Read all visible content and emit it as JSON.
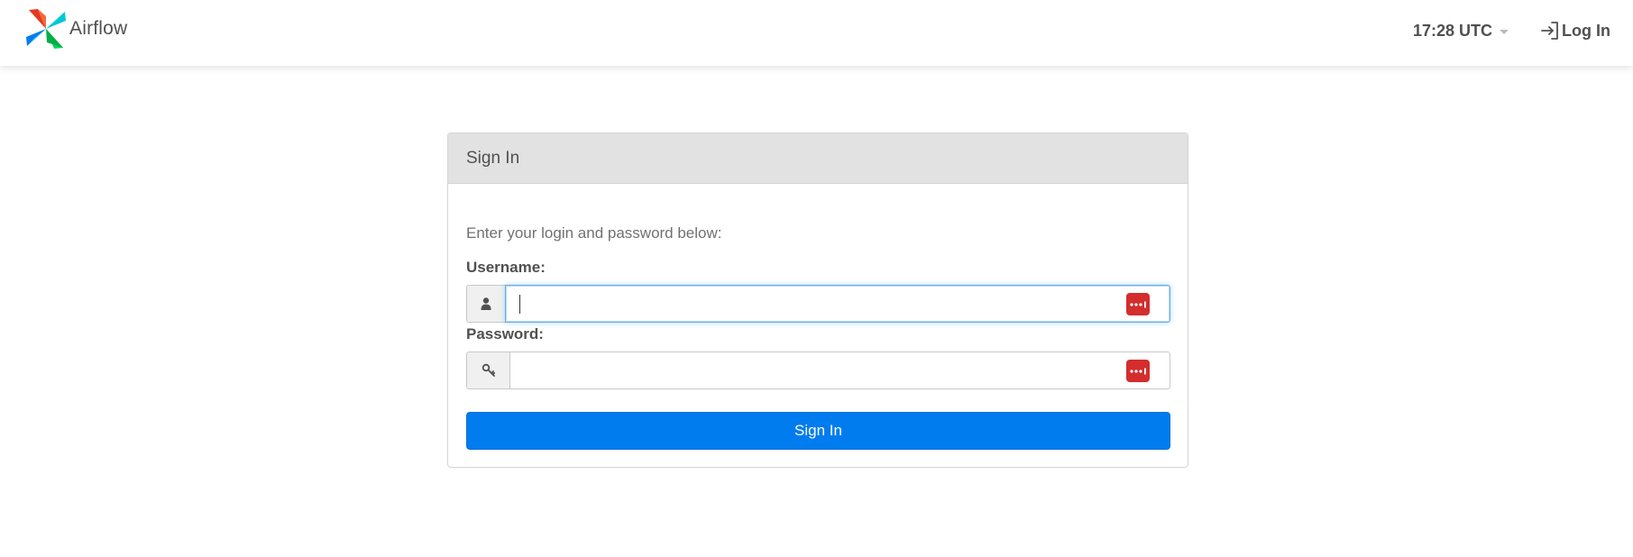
{
  "navbar": {
    "brand": {
      "name": "Airflow",
      "logo_icon": "airflow-pinwheel-logo"
    },
    "clock": {
      "time": "17:28 UTC",
      "caret_icon": "chevron-down-icon"
    },
    "login": {
      "label": "Log In",
      "icon": "sign-in-icon"
    }
  },
  "panel": {
    "title": "Sign In",
    "instruction": "Enter your login and password below:",
    "username": {
      "label": "Username:",
      "value": "",
      "placeholder": "",
      "addon_icon": "user-icon",
      "manager_icon": "password-manager-icon"
    },
    "password": {
      "label": "Password:",
      "value": "",
      "placeholder": "",
      "addon_icon": "key-icon",
      "manager_icon": "password-manager-icon"
    },
    "submit_label": "Sign In"
  },
  "colors": {
    "primary_button": "#017cee",
    "panel_heading_bg": "#e2e2e2",
    "password_manager_badge": "#d32d2d",
    "focus_ring": "#66afe9",
    "text": "#51504f"
  }
}
